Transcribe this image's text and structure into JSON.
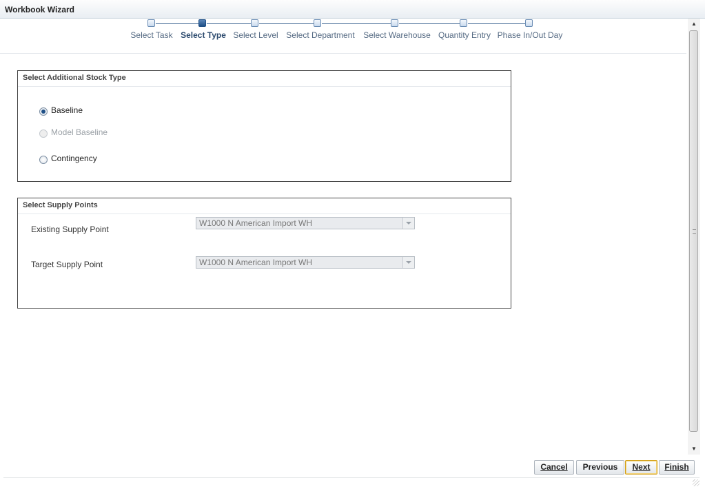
{
  "window": {
    "title": "Workbook Wizard"
  },
  "train": {
    "steps": [
      {
        "label": "Select Task",
        "state": "visited"
      },
      {
        "label": "Select Type",
        "state": "current"
      },
      {
        "label": "Select Level",
        "state": "unvisited"
      },
      {
        "label": "Select Department",
        "state": "unvisited"
      },
      {
        "label": "Select Warehouse",
        "state": "unvisited"
      },
      {
        "label": "Quantity Entry",
        "state": "unvisited"
      },
      {
        "label": "Phase In/Out Day",
        "state": "unvisited"
      }
    ]
  },
  "stock_type": {
    "header": "Select Additional Stock Type",
    "options": [
      {
        "label": "Baseline",
        "checked": true,
        "disabled": false
      },
      {
        "label": "Model Baseline",
        "checked": false,
        "disabled": true
      },
      {
        "label": "Contingency",
        "checked": false,
        "disabled": false
      }
    ]
  },
  "supply_points": {
    "header": "Select Supply Points",
    "existing": {
      "label": "Existing Supply Point",
      "value": "W1000 N American Import WH"
    },
    "target": {
      "label": "Target Supply Point",
      "value": "W1000 N American Import WH"
    }
  },
  "buttons": {
    "cancel": {
      "first": "C",
      "rest": "ancel"
    },
    "previous": "Previous",
    "next": {
      "first": "N",
      "rest": "ext"
    },
    "finish": {
      "first": "F",
      "rest": "inish"
    }
  },
  "colors": {
    "accent": "#1f4f86",
    "default_button_border": "#d4a017"
  }
}
